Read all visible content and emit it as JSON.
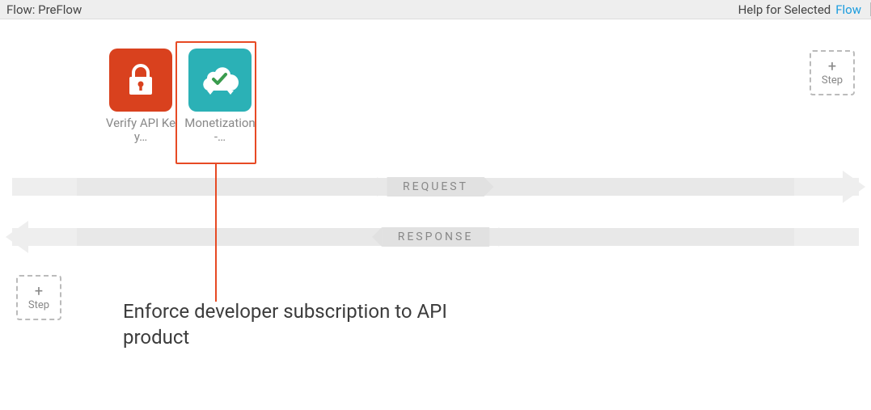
{
  "header": {
    "title": "Flow: PreFlow",
    "help_label": "Help for Selected",
    "help_link": "Flow"
  },
  "policies": [
    {
      "id": "verify-api-key",
      "label": "Verify API Key…",
      "icon": "lock",
      "color": "red",
      "selected": false
    },
    {
      "id": "monetization",
      "label": "Monetization-…",
      "icon": "cloud-check",
      "color": "teal",
      "selected": true
    }
  ],
  "flow": {
    "request_label": "REQUEST",
    "response_label": "RESPONSE"
  },
  "buttons": {
    "add_step": "Step",
    "plus": "+"
  },
  "annotation": "Enforce developer subscription to API product"
}
